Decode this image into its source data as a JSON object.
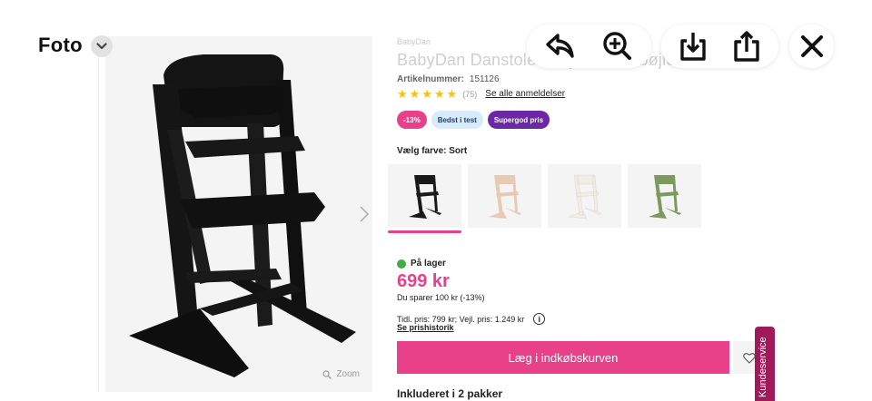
{
  "viewer": {
    "title": "Foto",
    "toolbar": {
      "undo": "undo-icon",
      "zoom": "zoom-in-icon",
      "save": "download-icon",
      "share": "share-icon",
      "close": "close-icon"
    }
  },
  "product": {
    "brand": "BabyDan",
    "title": "BabyDan Danstolen højstol inkl. bøjle + bakke",
    "article_label": "Artikelnummer:",
    "article_number": "151126",
    "rating": {
      "stars": 5,
      "count": "(75)",
      "link": "Se alle anmeldelser"
    },
    "badges": [
      "-13%",
      "Bedst i test",
      "Supergod pris"
    ],
    "color_label": "Vælg farve: Sort",
    "swatches": [
      {
        "name": "Sort",
        "color": "#1a1a1a",
        "selected": true
      },
      {
        "name": "Natur",
        "color": "#e8c9b4",
        "selected": false
      },
      {
        "name": "Hvid",
        "color": "#f0ede6",
        "selected": false
      },
      {
        "name": "Grøn",
        "color": "#7d9a5e",
        "selected": false
      }
    ],
    "stock": "På lager",
    "price": "699 kr",
    "saving": "Du sparer 100 kr (-13%)",
    "previous_price": "Tidl. pris: 799 kr; Vejl. pris: 1.249 kr",
    "price_history": "Se prishistorik",
    "cart_button": "Læg i indkøbskurven",
    "included": "Inkluderet i 2 pakker",
    "zoom_hint": "Zoom"
  },
  "kundeservice": "Kundeservice",
  "colors": {
    "accent": "#e8418a",
    "purple": "#6b27a8",
    "stock": "#3faa46",
    "service": "#a0195a"
  }
}
